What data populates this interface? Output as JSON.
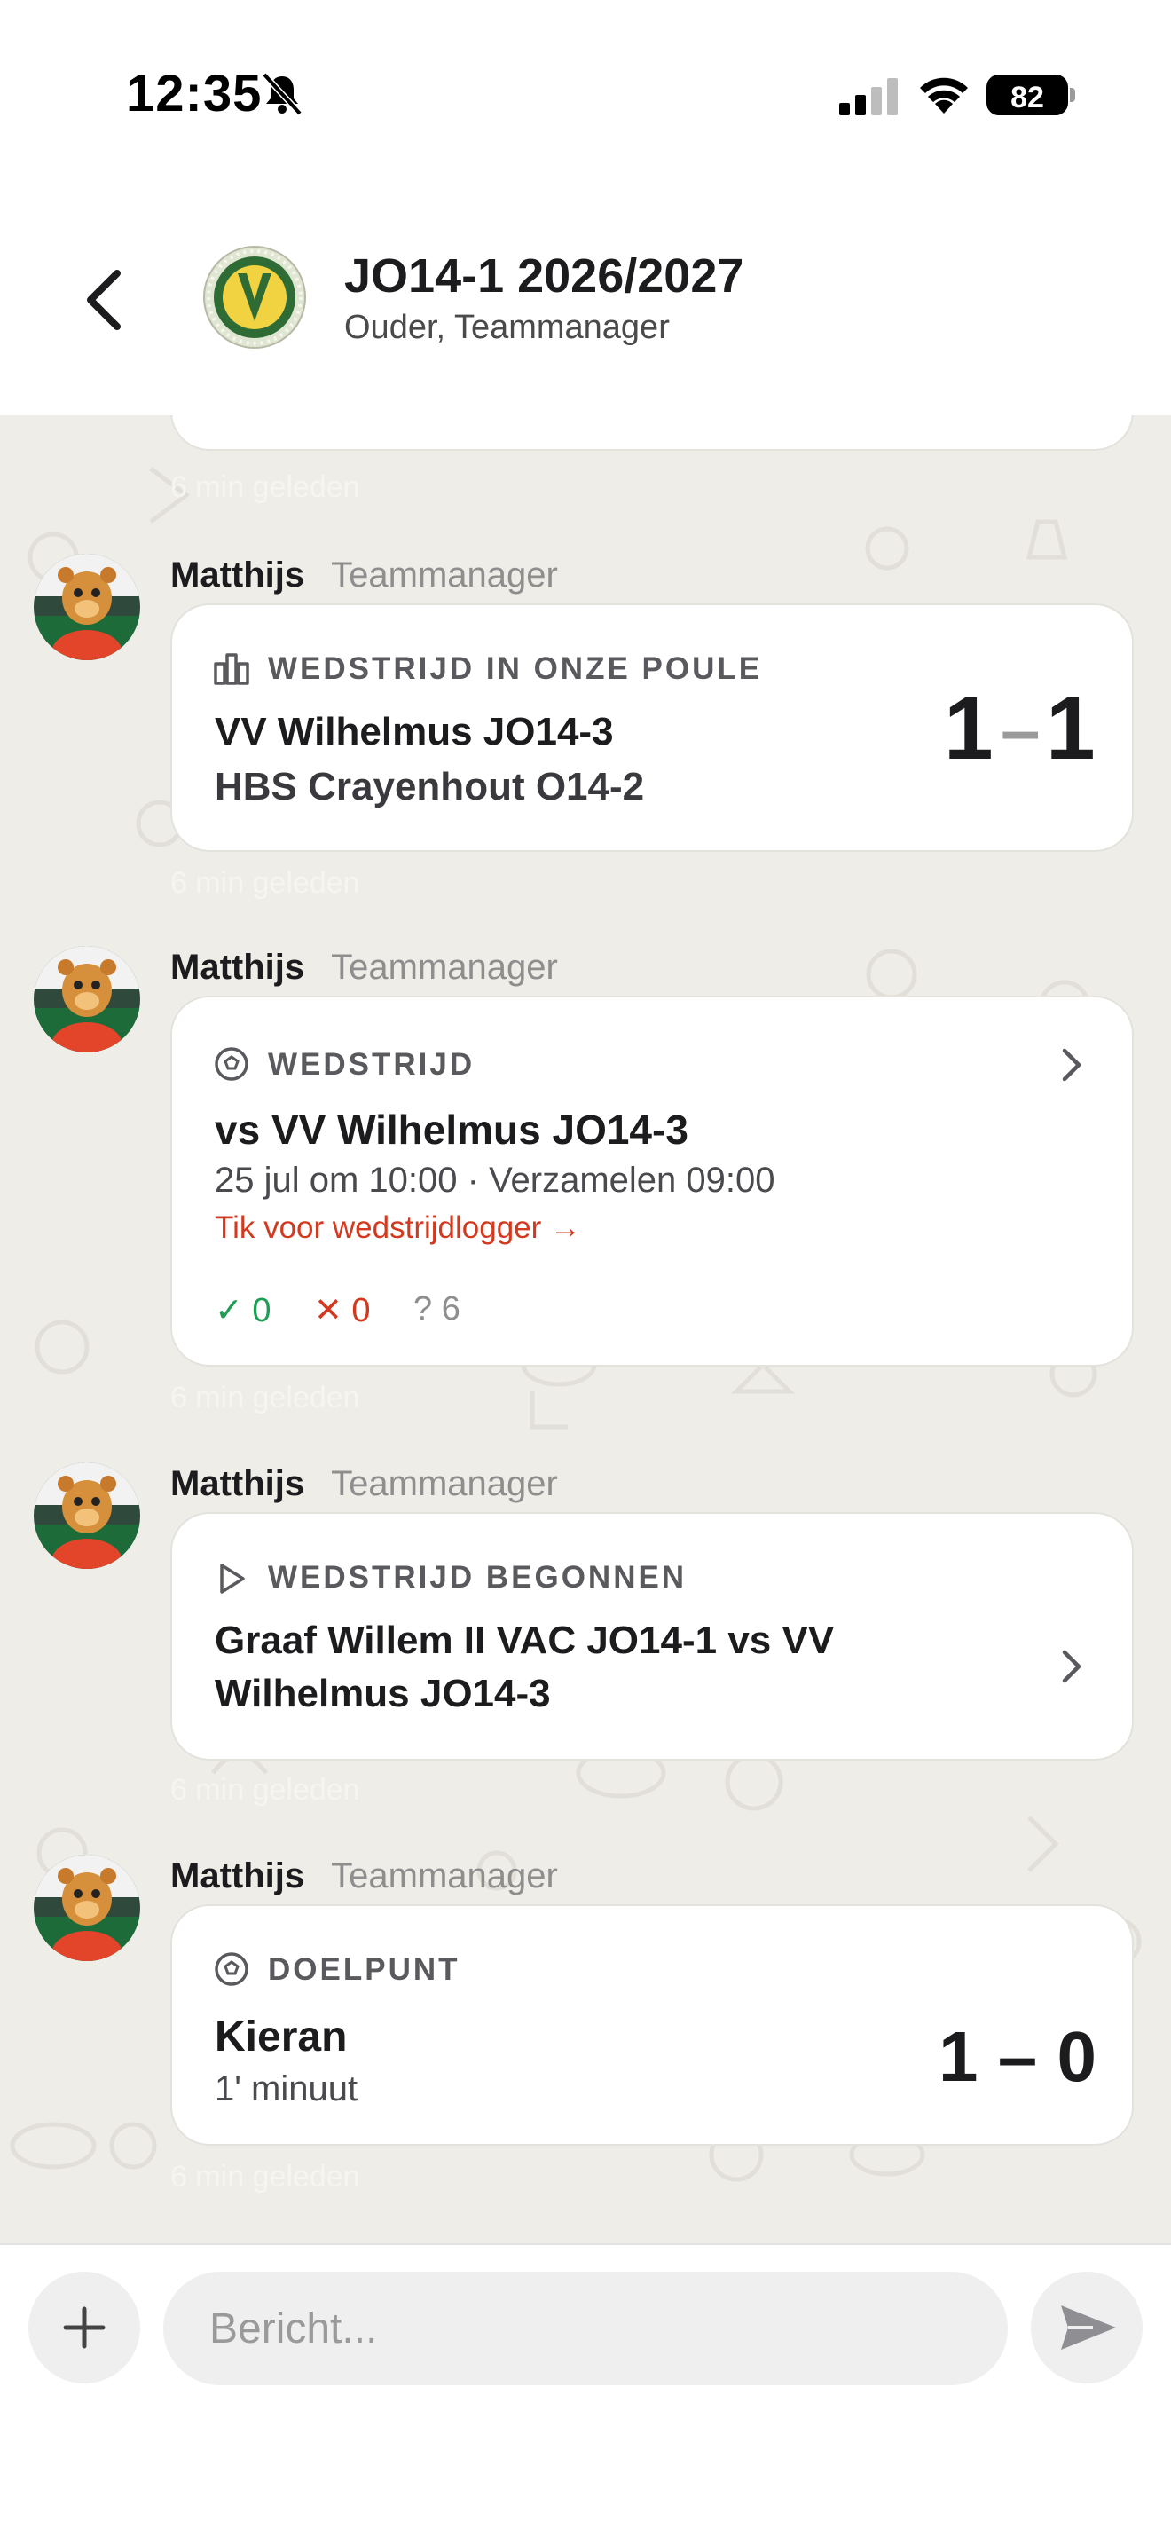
{
  "status_bar": {
    "time": "12:35",
    "battery": "82"
  },
  "header": {
    "title": "JO14-1 2026/2027",
    "subtitle": "Ouder, Teammanager"
  },
  "messages": [
    {
      "time": "6 min geleden",
      "sender": "Matthijs",
      "role": "Teammanager",
      "type_label": "WEDSTRIJD IN ONZE POULE",
      "icon": "stadium-icon",
      "home": "VV Wilhelmus JO14-3",
      "away": "HBS Crayenhout O14-2",
      "score_home": "1",
      "score_sep": "–",
      "score_away": "1"
    },
    {
      "time": "6 min geleden",
      "sender": "Matthijs",
      "role": "Teammanager",
      "type_label": "WEDSTRIJD",
      "icon": "soccer-ball-icon",
      "title": "vs VV Wilhelmus JO14-3",
      "when": "25 jul om 10:00 · Verzamelen 09:00",
      "link": "Tik voor wedstrijdlogger →",
      "rsvp_yes": "✓ 0",
      "rsvp_no": "✕ 0",
      "rsvp_maybe": "? 6"
    },
    {
      "time": "6 min geleden",
      "sender": "Matthijs",
      "role": "Teammanager",
      "type_label": "WEDSTRIJD BEGONNEN",
      "icon": "play-icon",
      "title_line1": "Graaf Willem II VAC JO14-1 vs VV",
      "title_line2": "Wilhelmus JO14-3"
    },
    {
      "time": "6 min geleden",
      "sender": "Matthijs",
      "role": "Teammanager",
      "type_label": "DOELPUNT",
      "icon": "soccer-ball-icon",
      "player": "Kieran",
      "minute": "1' minuut",
      "score": "1 – 0"
    }
  ],
  "composer": {
    "placeholder": "Bericht..."
  },
  "colors": {
    "chat_background": "#efede8",
    "accent_red": "#d2391f",
    "accent_green": "#1f9d55"
  }
}
